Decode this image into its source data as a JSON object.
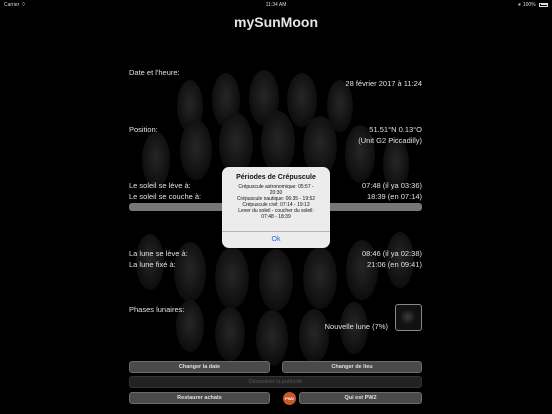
{
  "status": {
    "carrier": "Carrier",
    "time": "11:34 AM",
    "battery": "100%"
  },
  "app": {
    "title": "mySunMoon"
  },
  "date": {
    "label": "Date et l'heure:",
    "value": "28 février 2017 à 11:24"
  },
  "position": {
    "label": "Position:",
    "coords": "51.51°N 0.13°O",
    "place": "(Unit G2 Piccadilly)"
  },
  "sun": {
    "rise_label": "Le soleil se lève à:",
    "rise_value": "07:48 (il ya 03:36)",
    "set_label": "Le soleil se couche à:",
    "set_value": "18:39 (en 07:14)"
  },
  "moon": {
    "rise_label": "La lune se lève à:",
    "rise_value": "08:46 (il ya 02:38)",
    "set_label": "La lune fixé à:",
    "set_value": "21:06 (en 09:41)"
  },
  "phases": {
    "label": "Phases lunaires:",
    "value": "Nouvelle lune (7%)"
  },
  "buttons": {
    "change_date": "Changer la date",
    "change_place": "Changer de lieu",
    "disable_ads": "Désactiver la publicité",
    "restore": "Restaurer achats",
    "pw_badge": "PW2",
    "what_is": "Qui est PW2"
  },
  "alert": {
    "title": "Périodes de Crépuscule",
    "lines": [
      "Crépuscule astronomique: 05:57 -",
      "20:30",
      "Crépuscule nautique: 06:35 - 19:52",
      "Crépuscule civil: 07:14 - 19:13",
      "Lever du soleil - coucher du soleil:",
      "07:48 - 18:39"
    ],
    "ok": "Ok"
  }
}
